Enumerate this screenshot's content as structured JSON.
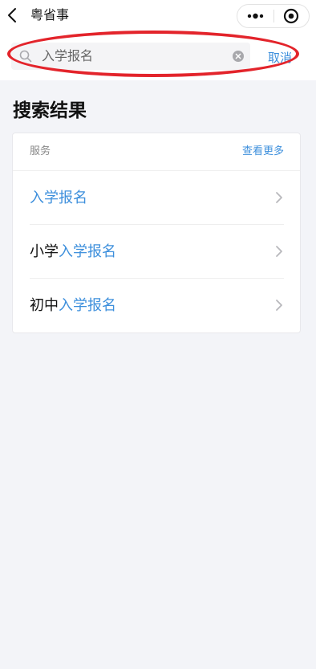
{
  "topbar": {
    "app_title": "粤省事"
  },
  "search": {
    "value": "入学报名",
    "cancel_label": "取消"
  },
  "results": {
    "heading": "搜索结果",
    "section_label": "服务",
    "more_label": "查看更多",
    "items": [
      {
        "prefix": "",
        "match": "入学报名"
      },
      {
        "prefix": "小学",
        "match": "入学报名"
      },
      {
        "prefix": "初中",
        "match": "入学报名"
      }
    ]
  },
  "colors": {
    "accent": "#3d8fdc",
    "annotation": "#e3242b",
    "background": "#f3f4f8"
  }
}
